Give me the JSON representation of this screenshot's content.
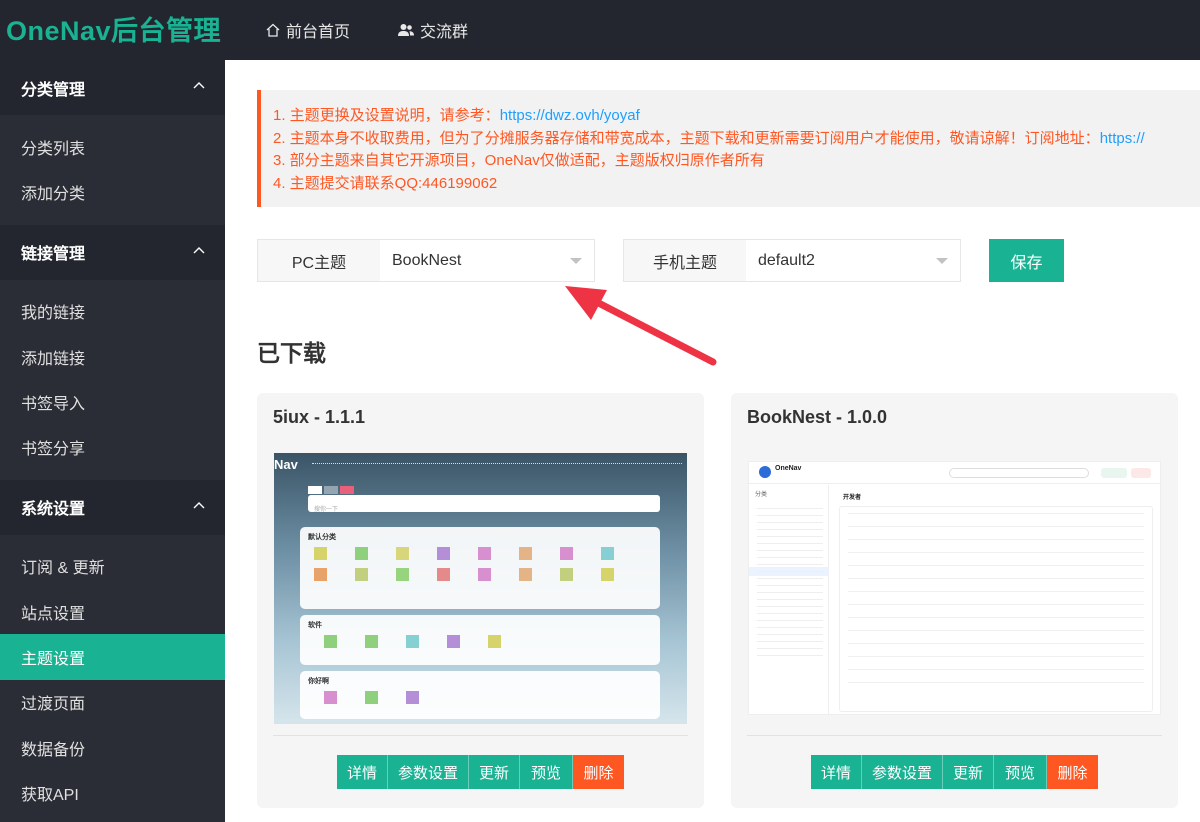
{
  "header": {
    "logo": "OneNav后台管理",
    "nav": [
      {
        "label": "前台首页",
        "icon": "home-icon"
      },
      {
        "label": "交流群",
        "icon": "users-icon"
      }
    ]
  },
  "sidebar": {
    "groups": [
      {
        "label": "分类管理",
        "items": [
          "分类列表",
          "添加分类"
        ]
      },
      {
        "label": "链接管理",
        "items": [
          "我的链接",
          "添加链接",
          "书签导入",
          "书签分享"
        ]
      },
      {
        "label": "系统设置",
        "items": [
          "订阅 & 更新",
          "站点设置",
          "主题设置",
          "过渡页面",
          "数据备份",
          "获取API"
        ]
      }
    ],
    "active": "主题设置"
  },
  "notice": {
    "line1_text": "1. 主题更换及设置说明，请参考：",
    "line1_link": "https://dwz.ovh/yoyaf",
    "line2_text": "2. 主题本身不收取费用，但为了分摊服务器存储和带宽成本，主题下载和更新需要订阅用户才能使用，敬请谅解！订阅地址：",
    "line2_link": "https://",
    "line3": "3. 部分主题来自其它开源项目，OneNav仅做适配，主题版权归原作者所有",
    "line4": "4. 主题提交请联系QQ:446199062"
  },
  "theme_select": {
    "pc_label": "PC主题",
    "pc_value": "BookNest",
    "mobile_label": "手机主题",
    "mobile_value": "default2",
    "save_label": "保存"
  },
  "downloaded": {
    "title": "已下载",
    "cards": [
      {
        "title": "5iux - 1.1.1",
        "preview": {
          "brand": "Nav",
          "search_placeholder": "搜你一下",
          "section1": "默认分类",
          "section2": "软件",
          "section3": "你好啊"
        }
      },
      {
        "title": "BookNest - 1.0.0",
        "preview": {
          "brand": "OneNav",
          "category_title": "开发者",
          "sidebar_title": "分类"
        }
      }
    ],
    "buttons": [
      "详情",
      "参数设置",
      "更新",
      "预览",
      "删除"
    ]
  },
  "colors": {
    "accent": "#19b394",
    "danger": "#ff5722",
    "link": "#1e9fff",
    "sidebar_bg": "#2a2d35",
    "topbar_bg": "#23262e"
  }
}
